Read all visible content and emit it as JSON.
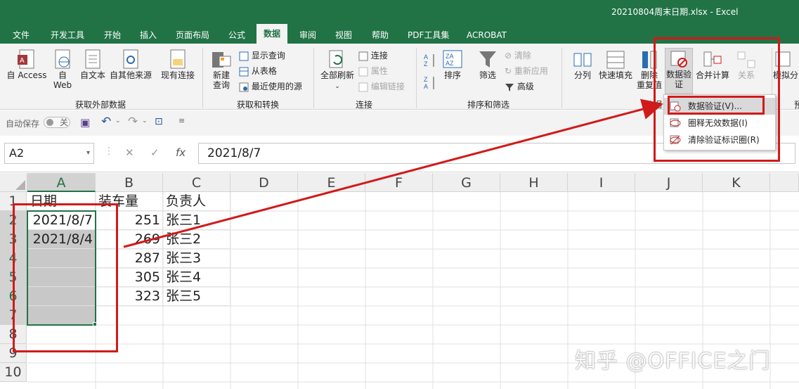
{
  "window": {
    "title": "20210804周末日期.xlsx  -  Excel"
  },
  "tabs": [
    "文件",
    "开发工具",
    "开始",
    "插入",
    "页面布局",
    "公式",
    "数据",
    "审阅",
    "视图",
    "帮助",
    "PDF工具集",
    "ACROBAT"
  ],
  "active_tab": "数据",
  "ribbon": {
    "external": {
      "access": "自 Access",
      "web_1": "自",
      "web_2": "Web",
      "text": "自文本",
      "other": "自其他来源",
      "existing": "现有连接",
      "group": "获取外部数据"
    },
    "transform": {
      "new_query_1": "新建",
      "new_query_2": "查询",
      "show_queries": "显示查询",
      "from_table": "从表格",
      "recent_sources": "最近使用的源",
      "group": "获取和转换"
    },
    "connections": {
      "refresh_all": "全部刷新",
      "connections": "连接",
      "properties": "属性",
      "edit_links": "编辑链接",
      "group": "连接"
    },
    "sort_filter": {
      "sort": "排序",
      "filter": "筛选",
      "clear": "清除",
      "reapply": "重新应用",
      "advanced": "高级",
      "group": "排序和筛选"
    },
    "data_tools": {
      "split": "分列",
      "flash_fill": "快速填充",
      "remove_dup_1": "删除",
      "remove_dup_2": "重复值",
      "validation_1": "数据验",
      "validation_2": "证",
      "consolidate": "合并计算",
      "relationships": "关系",
      "group_partial": "数据"
    },
    "forecast": {
      "whatif_partial": "模拟分",
      "group_partial": "预"
    }
  },
  "validation_menu": {
    "item1": "数据验证(V)...",
    "item2": "圈释无效数据(I)",
    "item3": "清除验证标识圈(R)"
  },
  "qat": {
    "autosave_label": "自动保存",
    "autosave_state": "关"
  },
  "formula_bar": {
    "name_box": "A2",
    "fx": "fx",
    "cancel": "✕",
    "enter": "✓",
    "content": "2021/8/7"
  },
  "columns": [
    "A",
    "B",
    "C",
    "D",
    "E",
    "F",
    "G",
    "H",
    "I",
    "J",
    "K"
  ],
  "rows": [
    "1",
    "2",
    "3",
    "4",
    "5",
    "6",
    "7",
    "8",
    "9",
    "10"
  ],
  "table": {
    "header": [
      "日期",
      "装车量",
      "负责人"
    ],
    "data": [
      [
        "2021/8/7",
        "251",
        "张三1"
      ],
      [
        "2021/8/4",
        "269",
        "张三2"
      ],
      [
        "",
        "287",
        "张三3"
      ],
      [
        "",
        "305",
        "张三4"
      ],
      [
        "",
        "323",
        "张三5"
      ]
    ]
  },
  "watermark": "知乎 @OFFICE之门",
  "colors": {
    "excel_green": "#217346",
    "annotation_red": "#d11a1a",
    "selection_gray": "#c8c8c8"
  }
}
